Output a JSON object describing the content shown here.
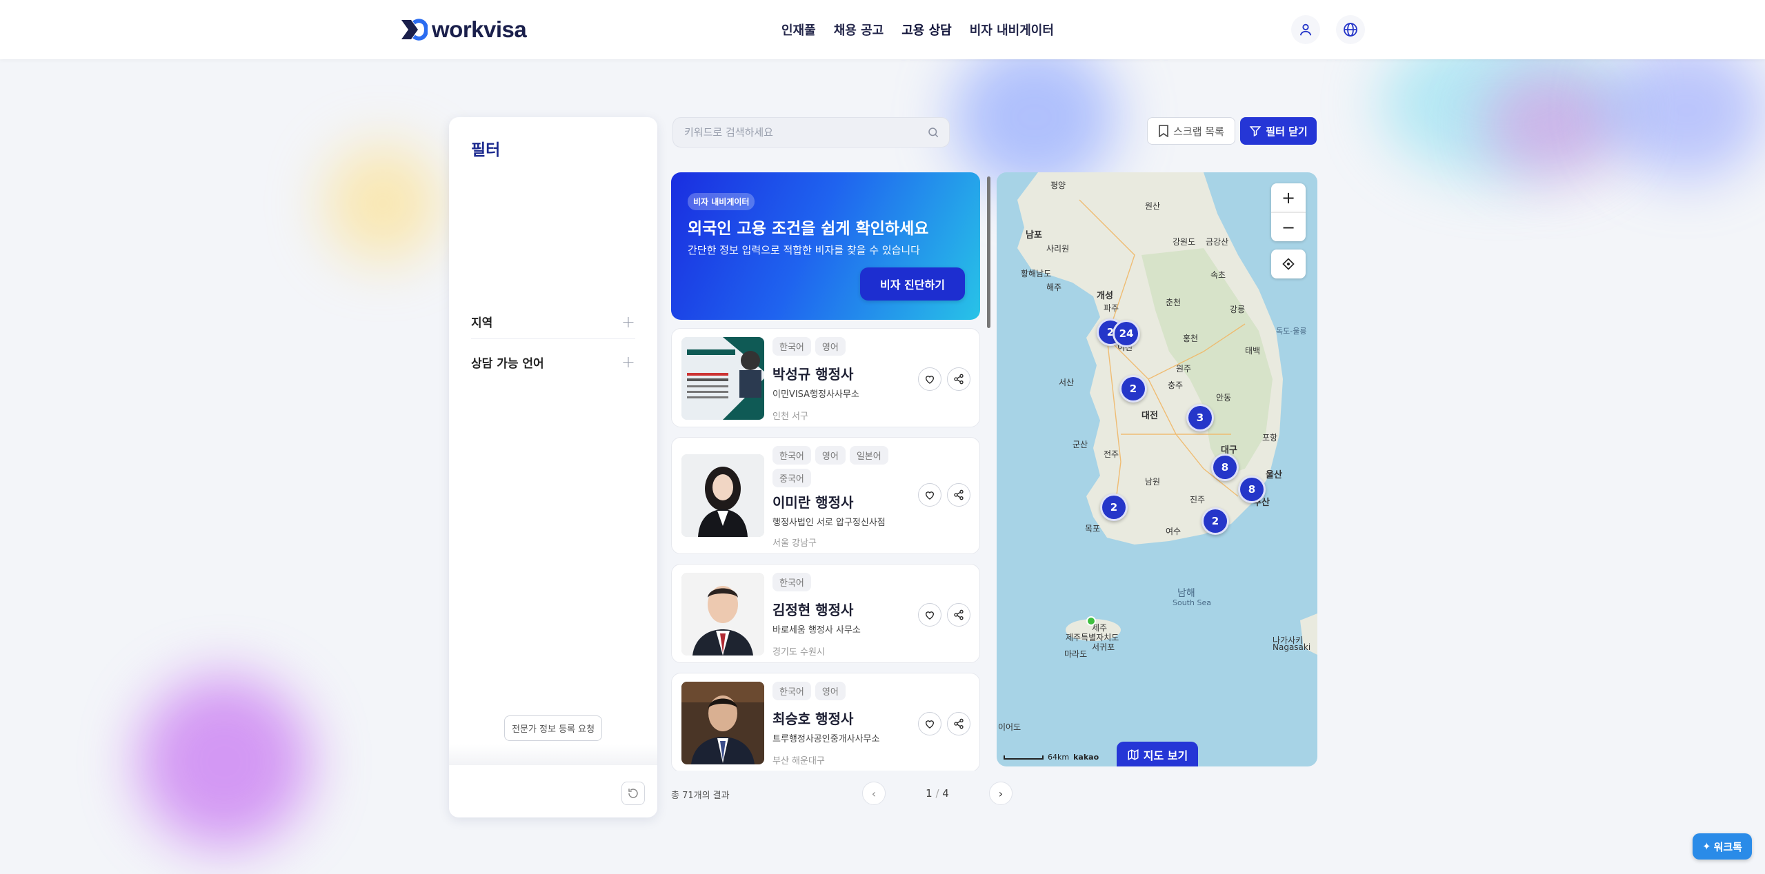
{
  "brand": {
    "name": "workvisa"
  },
  "nav": {
    "items": [
      "인재풀",
      "채용 공고",
      "고용 상담",
      "비자 내비게이터"
    ],
    "active": "고용 상담"
  },
  "filter": {
    "title": "필터",
    "sections": [
      "지역",
      "상담 가능 언어"
    ],
    "register_label": "전문가 정보 등록 요청"
  },
  "search": {
    "placeholder": "키워드로 검색하세요"
  },
  "toolbar": {
    "scrap_label": "스크랩 목록",
    "close_filter_label": "필터 닫기"
  },
  "banner": {
    "tag": "비자 내비게이터",
    "headline": "외국인 고용 조건을 쉽게 확인하세요",
    "sub": "간단한 정보 입력으로 적합한 비자를 찾을 수 있습니다",
    "cta": "비자 진단하기"
  },
  "experts": [
    {
      "langs": [
        "한국어",
        "영어"
      ],
      "name": "박성규 행정사",
      "office": "이민VISA행정사사무소",
      "location": "인천 서구"
    },
    {
      "langs": [
        "한국어",
        "영어",
        "일본어",
        "중국어"
      ],
      "name": "이미란 행정사",
      "office": "행정사법인 서로 압구정신사점",
      "location": "서울 강남구"
    },
    {
      "langs": [
        "한국어"
      ],
      "name": "김정현 행정사",
      "office": "바로세움 행정사 사무소",
      "location": "경기도 수원시"
    },
    {
      "langs": [
        "한국어",
        "영어"
      ],
      "name": "최승호 행정사",
      "office": "트루행정사공인중개사사무소",
      "location": "부산 해운대구"
    }
  ],
  "map": {
    "clusters": [
      "2",
      "24",
      "2",
      "3",
      "8",
      "8",
      "2",
      "2"
    ],
    "labels": [
      "평양",
      "남포",
      "사리원",
      "원산",
      "강원도",
      "금강산",
      "황해남도",
      "해주",
      "개성",
      "파주",
      "춘천",
      "속초",
      "강릉",
      "홍천",
      "원주",
      "이천",
      "서산",
      "충주",
      "태백",
      "안동",
      "대전",
      "군산",
      "전주",
      "대구",
      "포항",
      "울산",
      "남원",
      "진주",
      "부산",
      "목포",
      "여수",
      "제주",
      "제주특별자치도",
      "서귀포",
      "남해",
      "South Sea",
      "나가사키",
      "Nagasaki",
      "독도-울릉",
      "마라도",
      "이어도"
    ],
    "scale": "64km",
    "provider": "kakao",
    "view_label": "지도 보기"
  },
  "pagination": {
    "total_text": "총 71개의 결과",
    "current": "1",
    "total": "4"
  },
  "chatbot": {
    "label": "워크톡"
  }
}
